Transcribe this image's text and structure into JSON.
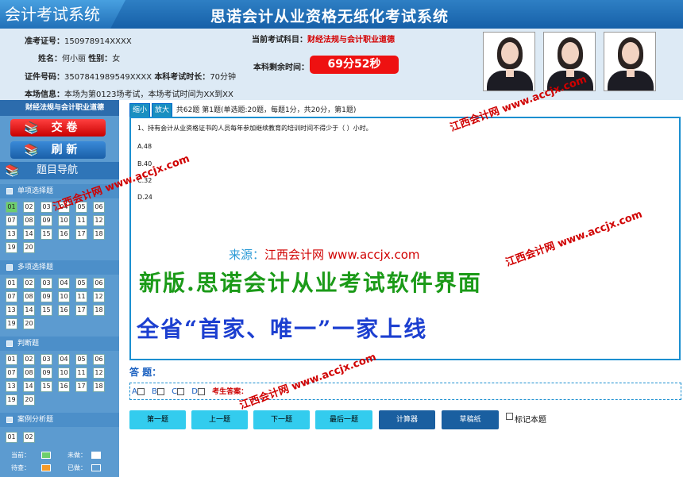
{
  "header": {
    "app_title": "会计考试系统",
    "system_title": "思诺会计从业资格无纸化考试系统"
  },
  "info": {
    "ticket_label": "准考证号：",
    "ticket_value": "150978914XXXX",
    "name_label": "姓名：",
    "name_value": "何小丽",
    "gender_label": "性别：",
    "gender_value": "女",
    "id_label": "证件号码：",
    "id_value": "3507841989549XXXX",
    "duration_label": "本科考试时长：",
    "duration_value": "70分钟",
    "room_label": "本场信息：",
    "room_value": "本场为第0123场考试，本场考试时间为XX到XX",
    "subject_label": "当前考试科目：",
    "subject_value": "财经法规与会计职业道德",
    "remaining_label": "本科剩余时间：",
    "remaining_value": "69分52秒"
  },
  "sidebar": {
    "subject": "财经法规与会计职业道德",
    "submit_label": "交 卷",
    "refresh_label": "刷 新",
    "nav_title": "题目导航",
    "sections": [
      {
        "title": "单项选择题",
        "numbers": [
          "01",
          "02",
          "03",
          "04",
          "05",
          "06",
          "07",
          "08",
          "09",
          "10",
          "11",
          "12",
          "13",
          "14",
          "15",
          "16",
          "17",
          "18",
          "19",
          "20"
        ]
      },
      {
        "title": "多项选择题",
        "numbers": [
          "01",
          "02",
          "03",
          "04",
          "05",
          "06",
          "07",
          "08",
          "09",
          "10",
          "11",
          "12",
          "13",
          "14",
          "15",
          "16",
          "17",
          "18",
          "19",
          "20"
        ]
      },
      {
        "title": "判断题",
        "numbers": [
          "01",
          "02",
          "03",
          "04",
          "05",
          "06",
          "07",
          "08",
          "09",
          "10",
          "11",
          "12",
          "13",
          "14",
          "15",
          "16",
          "17",
          "18",
          "19",
          "20"
        ]
      },
      {
        "title": "案例分析题",
        "numbers": [
          "01",
          "02"
        ]
      }
    ],
    "legend": {
      "current": "当前：",
      "undone": "未做：",
      "pending": "待查：",
      "done": "已做："
    }
  },
  "toolbar": {
    "zoom_out": "缩小",
    "zoom_in": "放大",
    "summary": "共62题 第1题(单选题:20题，每题1分，共20分，第1题)"
  },
  "question": {
    "text": "1、持有会计从业资格证书的人员每年参加继续教育的培训时间不得少于（  ）小时。",
    "options": [
      "A.48",
      "B.40",
      "C.32",
      "D.24"
    ]
  },
  "answer": {
    "label": "答 题：",
    "choices": [
      "A",
      "B",
      "C",
      "D"
    ],
    "examinee_label": "考生答案："
  },
  "buttons": {
    "first": "第一题",
    "prev": "上一题",
    "next": "下一题",
    "last": "最后一题",
    "calculator": "计算器",
    "draft": "草稿纸",
    "mark": "标记本题"
  },
  "overlay": {
    "source_label": "来源：",
    "source_value": "江西会计网 www.accjx.com",
    "promo_line1": "新版.思诺会计从业考试软件界面",
    "promo_line2": "全省“首家、唯一”一家上线",
    "watermark_cn": "江西会计网",
    "watermark_url": "www.accjx.com"
  },
  "colors": {
    "header": "#1660a8",
    "timer": "#ee1111",
    "sidebar": "#5c9bd0",
    "accent": "#1b8fd0",
    "current_marker": "#6dcf6d",
    "pending_marker": "#f49a2a"
  }
}
